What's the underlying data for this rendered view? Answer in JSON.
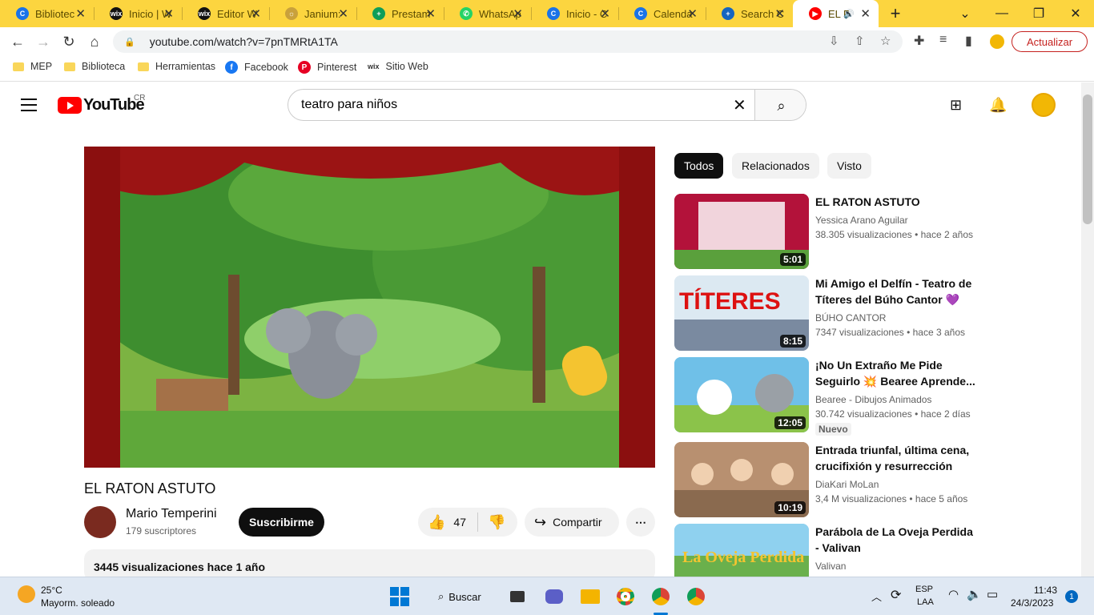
{
  "tabs": [
    {
      "label": "Bibliotec",
      "color": "#1a73e8",
      "glyph": "C"
    },
    {
      "label": "Inicio | W",
      "color": "#111",
      "glyph": "wix"
    },
    {
      "label": "Editor W",
      "color": "#111",
      "glyph": "wix"
    },
    {
      "label": "Janium:",
      "color": "#c9a13b",
      "glyph": "☼"
    },
    {
      "label": "Prestam",
      "color": "#0f9d58",
      "glyph": "+"
    },
    {
      "label": "WhatsAp",
      "color": "#25d366",
      "glyph": "✆"
    },
    {
      "label": "Inicio - C",
      "color": "#1a73e8",
      "glyph": "C"
    },
    {
      "label": "Calenda",
      "color": "#1a73e8",
      "glyph": "C"
    },
    {
      "label": "Search C",
      "color": "#1565c0",
      "glyph": "+"
    },
    {
      "label": "EL R",
      "color": "#f00",
      "glyph": "▶"
    }
  ],
  "window": {
    "minimize": "—",
    "maximize": "❐",
    "close": "✕",
    "newtab": "+",
    "tabsearch": "⌄"
  },
  "url": "youtube.com/watch?v=7pnTMRtA1TA",
  "update_label": "Actualizar",
  "bookmarks": [
    {
      "label": "MEP",
      "type": "folder"
    },
    {
      "label": "Biblioteca",
      "type": "folder"
    },
    {
      "label": "Herramientas",
      "type": "folder"
    },
    {
      "label": "Facebook",
      "type": "facebook"
    },
    {
      "label": "Pinterest",
      "type": "pinterest"
    },
    {
      "label": "Sitio Web",
      "type": "wix"
    }
  ],
  "youtube": {
    "logo": "YouTube",
    "country": "CR",
    "search_value": "teatro para niños",
    "video_title": "EL RATON ASTUTO",
    "channel": "Mario Temperini",
    "subscribers": "179 suscriptores",
    "subscribe": "Suscribirme",
    "likes": "47",
    "share": "Compartir",
    "more": "⋯",
    "views_date": "3445 visualizaciones  hace 1 año",
    "chips": [
      "Todos",
      "Relacionados",
      "Visto"
    ],
    "recommendations": [
      {
        "title": "EL RATON ASTUTO",
        "channel": "Yessica Arano Aguilar",
        "meta": "38.305 visualizaciones  • hace 2 años",
        "duration": "5:01",
        "badge": ""
      },
      {
        "title": "Mi Amigo el Delfín - Teatro de Títeres del Búho Cantor 💜 🦉",
        "channel": "BÚHO CANTOR",
        "meta": "7347 visualizaciones  • hace 3 años",
        "duration": "8:15",
        "badge": ""
      },
      {
        "title": "¡No Un Extraño Me Pide Seguirlo 💥 Bearee Aprende...",
        "channel": "Bearee - Dibujos Animados",
        "meta": "30.742 visualizaciones  • hace 2 días",
        "duration": "12:05",
        "badge": "Nuevo"
      },
      {
        "title": "Entrada triunfal, última cena, crucifixión y resurrección de...",
        "channel": "DiaKari MoLan",
        "meta": "3,4 M visualizaciones  • hace 5 años",
        "duration": "10:19",
        "badge": ""
      },
      {
        "title": "Parábola de La Oveja Perdida - Valivan",
        "channel": "Valivan",
        "meta": "",
        "duration": "",
        "badge": ""
      }
    ],
    "thumb_texts": {
      "t2": "TÍTERES",
      "t5": "La Oveja Perdida"
    }
  },
  "taskbar": {
    "weather_temp": "25°C",
    "weather_desc": "Mayorm. soleado",
    "search": "Buscar",
    "lang1": "ESP",
    "lang2": "LAA",
    "time": "11:43",
    "date": "24/3/2023",
    "notif": "1"
  }
}
